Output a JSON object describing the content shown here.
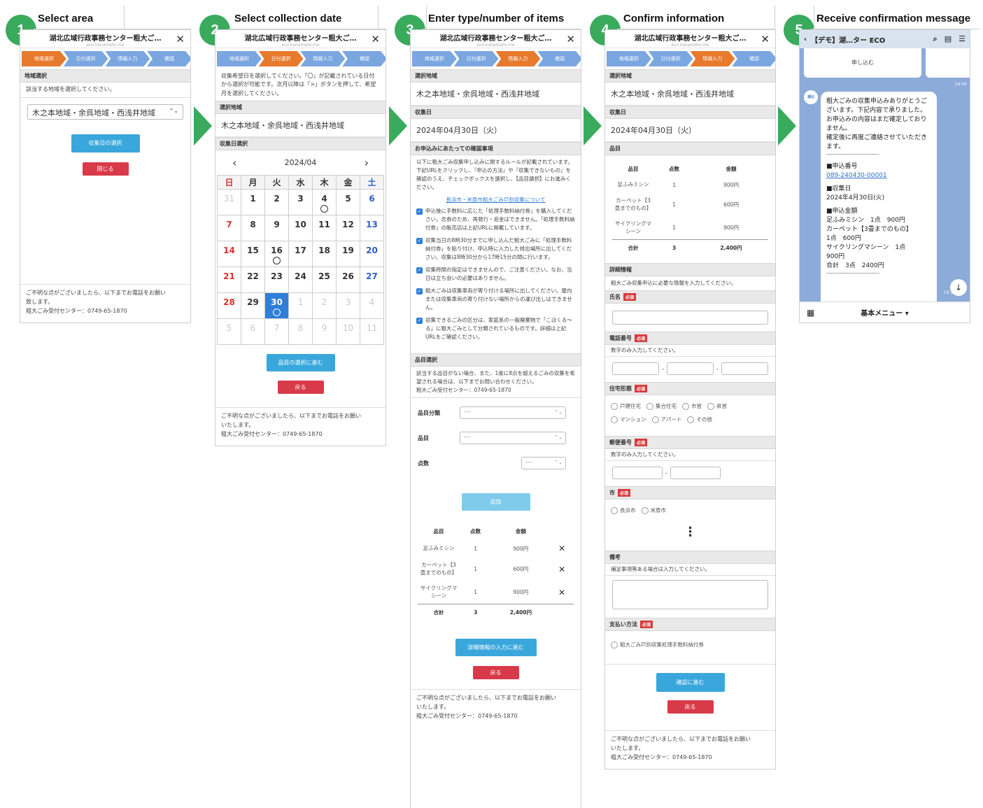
{
  "steps": [
    {
      "num": "1",
      "title": "Select area"
    },
    {
      "num": "2",
      "title": "Select collection date"
    },
    {
      "num": "3",
      "title": "Enter type/number of items"
    },
    {
      "num": "4",
      "title": "Confirm information"
    },
    {
      "num": "5",
      "title": "Receive confirmation message"
    }
  ],
  "phone": {
    "title": "湖北広域行政事務センター粗大ご…",
    "url": "eco.kanameto.me",
    "close": "✕",
    "progress": [
      "地域選択",
      "日付選択",
      "情報入力",
      "確認"
    ],
    "footer_line1": "ご不明な点がございましたら、以下までお電話をお願い",
    "footer_line2": "致します。",
    "footer_line2b": "いたします。",
    "footer_line3": "粗大ごみ受付センター：0749-65-1870"
  },
  "screen1": {
    "section": "地域選択",
    "instruction": "該当する地域を選択してください。",
    "selected_area": "木之本地域・余呉地域・西浅井地域",
    "btn_next": "収集日の選択",
    "btn_close": "閉じる"
  },
  "screen2": {
    "instruction": "収集希望日を選択してください。「〇」が記載されている日付から選択が可能です。次月以降は「>」ボタンを押して、希望月を選択してください。",
    "section_area": "選択地域",
    "area": "木之本地域・余呉地域・西浅井地域",
    "section_date": "収集日選択",
    "month": "2024/04",
    "prev": "‹",
    "next": "›",
    "weekdays": [
      "日",
      "月",
      "火",
      "水",
      "木",
      "金",
      "土"
    ],
    "days": [
      {
        "d": "31",
        "out": true
      },
      {
        "d": "1"
      },
      {
        "d": "2"
      },
      {
        "d": "3"
      },
      {
        "d": "4",
        "ok": true
      },
      {
        "d": "5"
      },
      {
        "d": "6"
      },
      {
        "d": "7"
      },
      {
        "d": "8"
      },
      {
        "d": "9"
      },
      {
        "d": "10"
      },
      {
        "d": "11"
      },
      {
        "d": "12"
      },
      {
        "d": "13"
      },
      {
        "d": "14"
      },
      {
        "d": "15"
      },
      {
        "d": "16",
        "ok": true
      },
      {
        "d": "17"
      },
      {
        "d": "18"
      },
      {
        "d": "19"
      },
      {
        "d": "20"
      },
      {
        "d": "21"
      },
      {
        "d": "22"
      },
      {
        "d": "23"
      },
      {
        "d": "24"
      },
      {
        "d": "25"
      },
      {
        "d": "26"
      },
      {
        "d": "27"
      },
      {
        "d": "28"
      },
      {
        "d": "29"
      },
      {
        "d": "30",
        "ok": true,
        "sel": true
      },
      {
        "d": "1",
        "out": true
      },
      {
        "d": "2",
        "out": true
      },
      {
        "d": "3",
        "out": true
      },
      {
        "d": "4",
        "out": true
      },
      {
        "d": "5",
        "out": true
      },
      {
        "d": "6",
        "out": true
      },
      {
        "d": "7",
        "out": true
      },
      {
        "d": "8",
        "out": true
      },
      {
        "d": "9",
        "out": true
      },
      {
        "d": "10",
        "out": true
      },
      {
        "d": "11",
        "out": true
      }
    ],
    "btn_next": "品目の選択に進む",
    "btn_back": "戻る"
  },
  "screen3": {
    "section_area": "選択地域",
    "area": "木之本地域・余呉地域・西浅井地域",
    "section_date": "収集日",
    "date": "2024年04月30日（火）",
    "section_rules": "お申込みにあたっての確認事項",
    "rules_intro": "以下に粗大ごみ収集申し込みに関するルールが記載されています。下記URLをクリックし、『申込の方法』や『収集できないもの』を確認のうえ、チェックボックスを選択し、【品目選択】にお進みください。",
    "rules_link": "長浜市・米原市粗大ごみ戸別収集について",
    "checks": [
      "申込後に手数料に応じた「処理手数料納付券」を購入してください。念券のため、再発行・返金はできません。「処理手数料納付券」の販売店は上記URLに掲載しています。",
      "収集当日の8時30分までに申し込んだ粗大ごみに「処理手数料納付券」を貼り付け、申込時に入力した排出場所に出してください。収集は8時30分から17時15分の間に行います。",
      "収集時間の指定はできませんので、ご注意ください。なお、当日は立ち会いの必要はありません。",
      "粗大ごみは収集車両が寄り付ける場所に出してください。屋内または収集車両の寄り付けない場所からの運び出しはできません。",
      "収集できるごみの区分は、家庭系の一般廃棄物で「こほくる～る」に粗大ごみとして分類されているものです。詳細は上記URLをご確認ください。"
    ],
    "section_items": "品目選択",
    "items_note": "該当する品目がない場合、また、1度に8点を超えるごみの収集を希望される場合は、以下までお問い合わせください。",
    "items_tel": "粗大ごみ受付センター：0749-65-1870",
    "label_category": "品目分類",
    "label_item": "品目",
    "label_qty": "点数",
    "placeholder": "----",
    "btn_add": "追加",
    "table_headers": [
      "品目",
      "点数",
      "金額"
    ],
    "rows": [
      {
        "name": "足ふみミシン",
        "qty": "1",
        "price": "900円"
      },
      {
        "name": "カーペット【3畳までのもの】",
        "qty": "1",
        "price": "600円"
      },
      {
        "name": "サイクリングマシーン",
        "qty": "1",
        "price": "900円"
      }
    ],
    "total_label": "合計",
    "total_qty": "3",
    "total_price": "2,400円",
    "remove": "✕",
    "btn_next": "詳細情報の入力に進む",
    "btn_back": "戻る"
  },
  "screen4": {
    "section_area": "選択地域",
    "area": "木之本地域・余呉地域・西浅井地域",
    "section_date": "収集日",
    "date": "2024年04月30日（火）",
    "section_items": "品目",
    "section_detail": "詳細情報",
    "detail_note": "粗大ごみ収集申込に必要な情報を入力してください。",
    "required": "必須",
    "label_name": "氏名",
    "label_phone": "電話番号",
    "phone_note": "数字のみ入力してください。",
    "label_housing": "住宅形態",
    "housing_options": [
      "戸建住宅",
      "集合住宅",
      "市営",
      "県営",
      "マンション",
      "アパート",
      "その他"
    ],
    "label_zip": "郵便番号",
    "zip_note": "数字のみ入力してください。",
    "label_city": "市",
    "city_options": [
      "長浜市",
      "米原市"
    ],
    "more": "⋮",
    "label_notes": "備考",
    "notes_hint": "補足事項等ある場合は入力してください。",
    "label_payment": "支払い方法",
    "payment_option": "粗大ごみ戸別収集処理手数料納付券",
    "btn_next": "確認に進む",
    "btn_back": "戻る"
  },
  "screen5": {
    "chat_title": "【デモ】湖…ター ECO",
    "apply_btn": "申し込む",
    "time1": "18:06",
    "avatar": "湖北ECO",
    "msg_lines": [
      "粗大ごみの収集申込みありがとうございます。下記内容で承りました。",
      "お申込みの内容はまだ確定しておりません。",
      "確定後に再度ご連絡させていただきます。",
      "-----------------------------------",
      "■申込番号",
      "089-240430-00001",
      "■収集日",
      "2024年4月30日(火)",
      "■申込金額",
      "足ふみミシン　1点　900円",
      "カーペット【3畳までのもの】",
      "1点　600円",
      "サイクリングマシーン　1点",
      "900円",
      "合計　3点　2400円",
      "-----------------------------------"
    ],
    "time2": "18:13",
    "menu": "基本メニュー ▾"
  }
}
